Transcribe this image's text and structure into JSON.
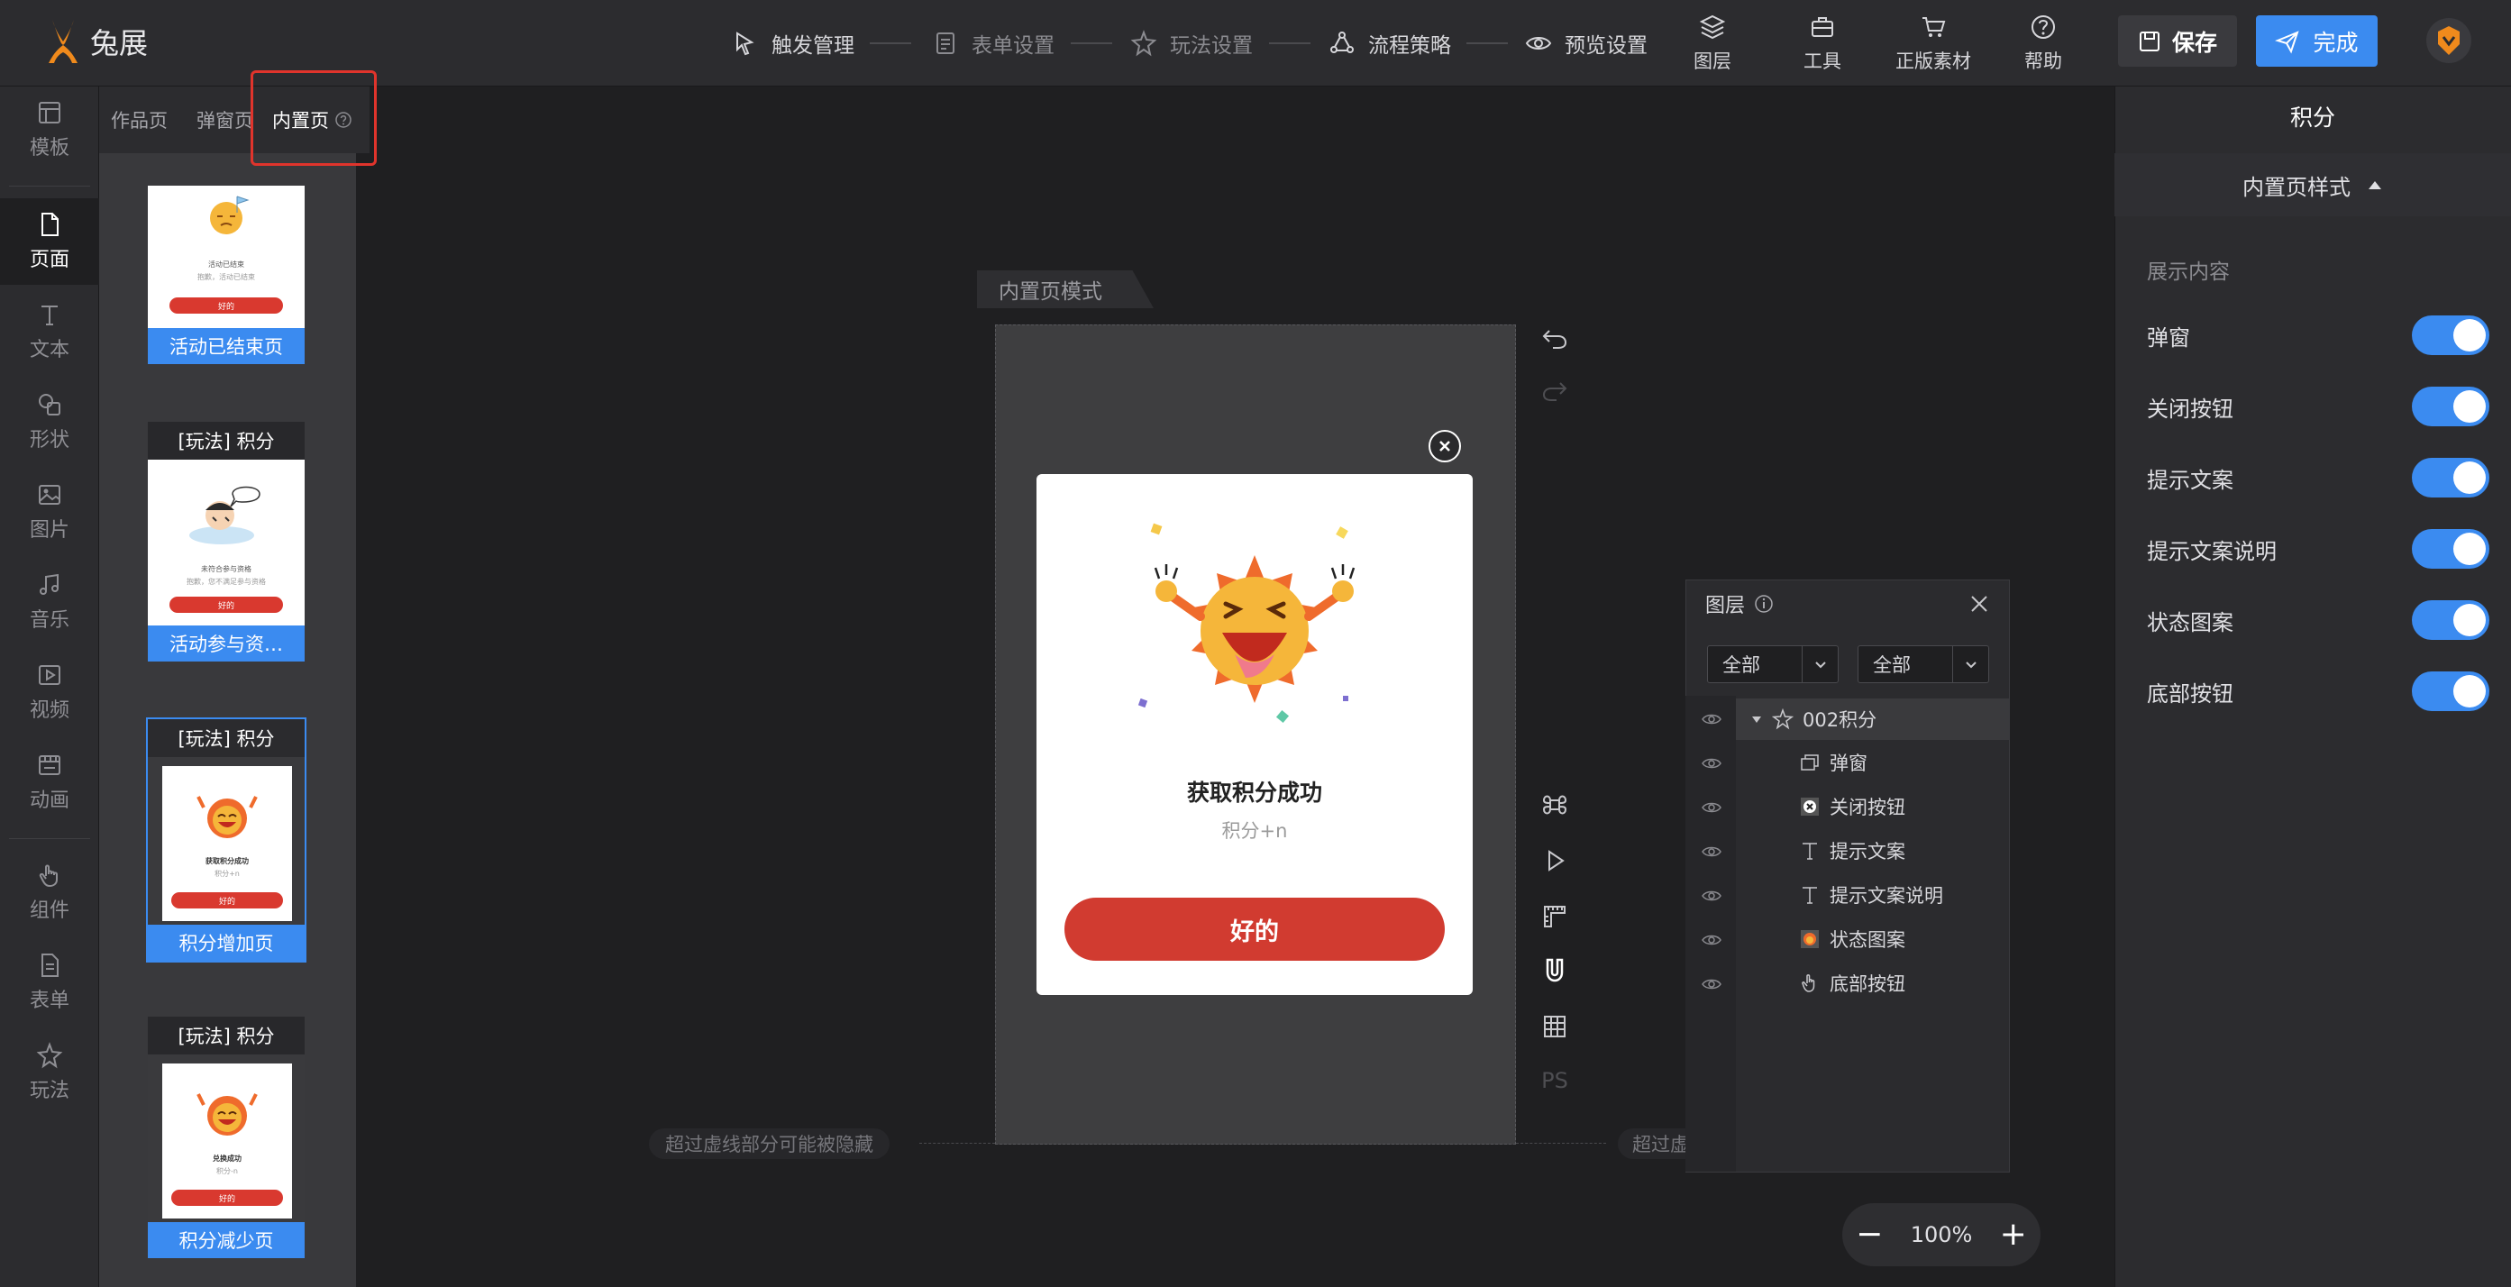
{
  "app": {
    "logo_text": "兔展"
  },
  "steps": [
    {
      "label": "触发管理"
    },
    {
      "label": "表单设置"
    },
    {
      "label": "玩法设置"
    },
    {
      "label": "流程策略"
    },
    {
      "label": "预览设置"
    }
  ],
  "tools": [
    {
      "label": "图层"
    },
    {
      "label": "工具"
    },
    {
      "label": "正版素材"
    },
    {
      "label": "帮助"
    }
  ],
  "actions": {
    "save": "保存",
    "done": "完成"
  },
  "leftnav": [
    {
      "label": "模板"
    },
    {
      "label": "页面"
    },
    {
      "label": "文本"
    },
    {
      "label": "形状"
    },
    {
      "label": "图片"
    },
    {
      "label": "音乐"
    },
    {
      "label": "视频"
    },
    {
      "label": "动画"
    },
    {
      "label": "组件"
    },
    {
      "label": "表单"
    },
    {
      "label": "玩法"
    }
  ],
  "pagetabs": [
    {
      "label": "作品页"
    },
    {
      "label": "弹窗页"
    },
    {
      "label": "内置页"
    }
  ],
  "pages": [
    {
      "head": "",
      "label": "活动已结束页",
      "mini_title": "活动已结束",
      "mini_sub": "抱歉，活动已结束",
      "mini_btn": "好的"
    },
    {
      "head": "[玩法] 积分",
      "label": "活动参与资…",
      "mini_title": "未符合参与资格",
      "mini_sub": "抱歉，您不满足参与资格",
      "mini_btn": "好的"
    },
    {
      "head": "[玩法] 积分",
      "label": "积分增加页",
      "mini_title": "获取积分成功",
      "mini_sub": "积分+n",
      "mini_btn": "好的"
    },
    {
      "head": "[玩法] 积分",
      "label": "积分减少页",
      "mini_title": "兑换成功",
      "mini_sub": "积分-n",
      "mini_btn": "好的"
    }
  ],
  "canvas": {
    "mode_tag": "内置页模式",
    "hint": "超过虚线部分可能被隐藏",
    "hint_right": "超过虚",
    "modal": {
      "title": "获取积分成功",
      "subtitle": "积分+n",
      "button": "好的"
    },
    "ps_label": "PS"
  },
  "layers": {
    "title": "图层",
    "filter1": "全部",
    "filter2": "全部",
    "items": [
      {
        "label": "002积分"
      },
      {
        "label": "弹窗"
      },
      {
        "label": "关闭按钮"
      },
      {
        "label": "提示文案"
      },
      {
        "label": "提示文案说明"
      },
      {
        "label": "状态图案"
      },
      {
        "label": "底部按钮"
      }
    ]
  },
  "zoom": {
    "value": "100%",
    "minus": "−",
    "plus": "+"
  },
  "rightpanel": {
    "title": "积分",
    "section": "内置页样式",
    "show_label": "展示内容",
    "items": [
      {
        "label": "弹窗",
        "on": true
      },
      {
        "label": "关闭按钮",
        "on": true
      },
      {
        "label": "提示文案",
        "on": true
      },
      {
        "label": "提示文案说明",
        "on": true
      },
      {
        "label": "状态图案",
        "on": true
      },
      {
        "label": "底部按钮",
        "on": true
      }
    ]
  },
  "colors": {
    "accent": "#3b8bf0",
    "brand_red": "#d13b30",
    "highlight": "#e0342c"
  }
}
